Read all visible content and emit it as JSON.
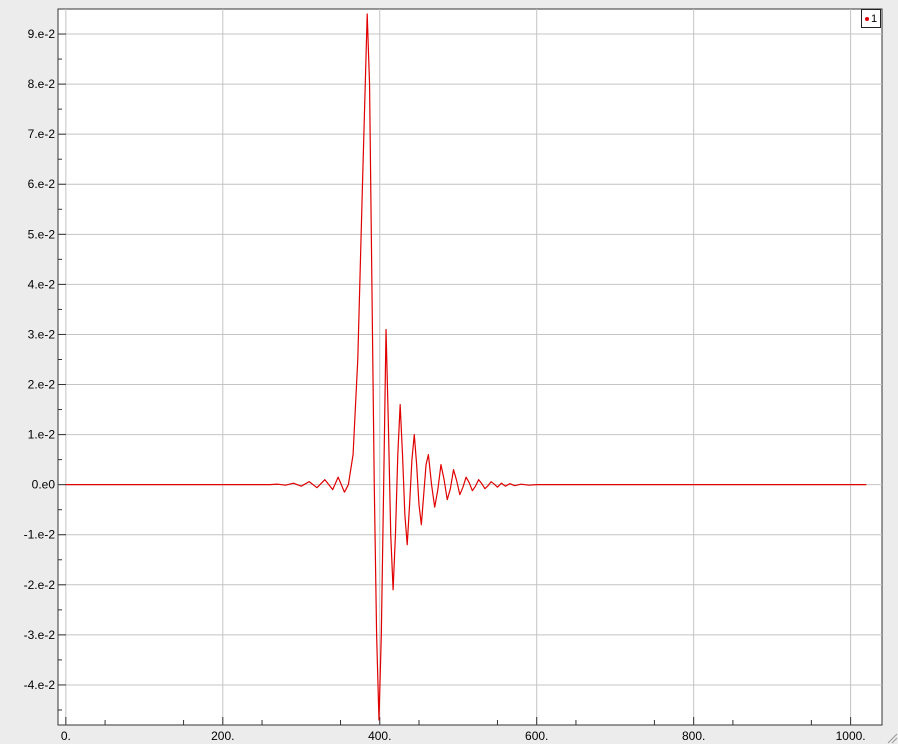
{
  "chart_data": {
    "type": "line",
    "title": "",
    "xlabel": "",
    "ylabel": "",
    "xlim": [
      -10,
      1040
    ],
    "ylim": [
      -0.048,
      0.095
    ],
    "x_ticks": [
      {
        "value": 0,
        "label": "0."
      },
      {
        "value": 200,
        "label": "200."
      },
      {
        "value": 400,
        "label": "400."
      },
      {
        "value": 600,
        "label": "600."
      },
      {
        "value": 800,
        "label": "800."
      },
      {
        "value": 1000,
        "label": "1000."
      }
    ],
    "y_ticks": [
      {
        "value": -0.04,
        "label": "-4.e-2"
      },
      {
        "value": -0.03,
        "label": "-3.e-2"
      },
      {
        "value": -0.02,
        "label": "-2.e-2"
      },
      {
        "value": -0.01,
        "label": "-1.e-2"
      },
      {
        "value": 0.0,
        "label": "0.e0"
      },
      {
        "value": 0.01,
        "label": "1.e-2"
      },
      {
        "value": 0.02,
        "label": "2.e-2"
      },
      {
        "value": 0.03,
        "label": "3.e-2"
      },
      {
        "value": 0.04,
        "label": "4.e-2"
      },
      {
        "value": 0.05,
        "label": "5.e-2"
      },
      {
        "value": 0.06,
        "label": "6.e-2"
      },
      {
        "value": 0.07,
        "label": "7.e-2"
      },
      {
        "value": 0.08,
        "label": "8.e-2"
      },
      {
        "value": 0.09,
        "label": "9.e-2"
      }
    ],
    "grid": true,
    "legend_position": "top-right",
    "series": [
      {
        "name": "1",
        "color": "#e00000",
        "points": [
          [
            0,
            0.0
          ],
          [
            200,
            0.0
          ],
          [
            260,
            0.0
          ],
          [
            270,
            0.0001
          ],
          [
            280,
            -0.0001
          ],
          [
            290,
            0.0003
          ],
          [
            300,
            -0.0003
          ],
          [
            310,
            0.0006
          ],
          [
            320,
            -0.0006
          ],
          [
            330,
            0.001
          ],
          [
            340,
            -0.001
          ],
          [
            347,
            0.0015
          ],
          [
            355,
            -0.0015
          ],
          [
            360,
            0.0
          ],
          [
            366,
            0.006
          ],
          [
            372,
            0.025
          ],
          [
            378,
            0.06
          ],
          [
            384,
            0.094
          ],
          [
            387,
            0.08
          ],
          [
            390,
            0.04
          ],
          [
            393,
            0.0
          ],
          [
            396,
            -0.03
          ],
          [
            399,
            -0.047
          ],
          [
            402,
            -0.03
          ],
          [
            405,
            0.0
          ],
          [
            408,
            0.031
          ],
          [
            411,
            0.012
          ],
          [
            414,
            -0.01
          ],
          [
            417,
            -0.021
          ],
          [
            420,
            -0.01
          ],
          [
            423,
            0.006
          ],
          [
            426,
            0.016
          ],
          [
            429,
            0.006
          ],
          [
            432,
            -0.006
          ],
          [
            435,
            -0.012
          ],
          [
            438,
            -0.004
          ],
          [
            441,
            0.005
          ],
          [
            444,
            0.01
          ],
          [
            447,
            0.004
          ],
          [
            450,
            -0.004
          ],
          [
            453,
            -0.008
          ],
          [
            456,
            -0.002
          ],
          [
            459,
            0.004
          ],
          [
            462,
            0.006
          ],
          [
            466,
            0.0
          ],
          [
            470,
            -0.0045
          ],
          [
            474,
            -0.001
          ],
          [
            478,
            0.004
          ],
          [
            482,
            0.001
          ],
          [
            486,
            -0.003
          ],
          [
            490,
            -0.0008
          ],
          [
            494,
            0.003
          ],
          [
            498,
            0.0008
          ],
          [
            502,
            -0.002
          ],
          [
            506,
            -0.0005
          ],
          [
            510,
            0.0015
          ],
          [
            514,
            0.0004
          ],
          [
            518,
            -0.0012
          ],
          [
            522,
            -0.0003
          ],
          [
            526,
            0.001
          ],
          [
            530,
            0.0002
          ],
          [
            534,
            -0.0008
          ],
          [
            538,
            -0.0002
          ],
          [
            542,
            0.0006
          ],
          [
            546,
            0.0001
          ],
          [
            550,
            -0.0005
          ],
          [
            555,
            0.0003
          ],
          [
            560,
            -0.0003
          ],
          [
            566,
            0.0002
          ],
          [
            572,
            -0.0002
          ],
          [
            580,
            0.0001
          ],
          [
            590,
            -0.0001
          ],
          [
            600,
            0.0
          ],
          [
            650,
            0.0
          ],
          [
            800,
            0.0
          ],
          [
            1020,
            0.0
          ]
        ]
      }
    ]
  },
  "legend": {
    "label": "1",
    "color": "#e00000"
  }
}
